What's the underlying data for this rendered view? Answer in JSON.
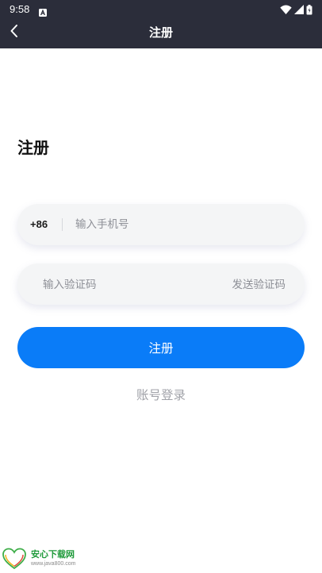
{
  "status_bar": {
    "time": "9:58"
  },
  "app_bar": {
    "title": "注册"
  },
  "form": {
    "heading": "注册",
    "phone": {
      "country_code": "+86",
      "placeholder": "输入手机号",
      "value": ""
    },
    "code": {
      "placeholder": "输入验证码",
      "value": "",
      "send_label": "发送验证码"
    },
    "submit_label": "注册",
    "login_link": "账号登录"
  },
  "watermark": {
    "title": "安心下载网",
    "url": "www.java800.com",
    "logo_text": [
      "放心",
      "来"
    ]
  },
  "colors": {
    "header_bg": "#2b2d3a",
    "accent": "#0a7cf8",
    "field_bg": "#f4f5f6",
    "muted_text": "#a0a2a8",
    "placeholder": "#8d8f96"
  }
}
